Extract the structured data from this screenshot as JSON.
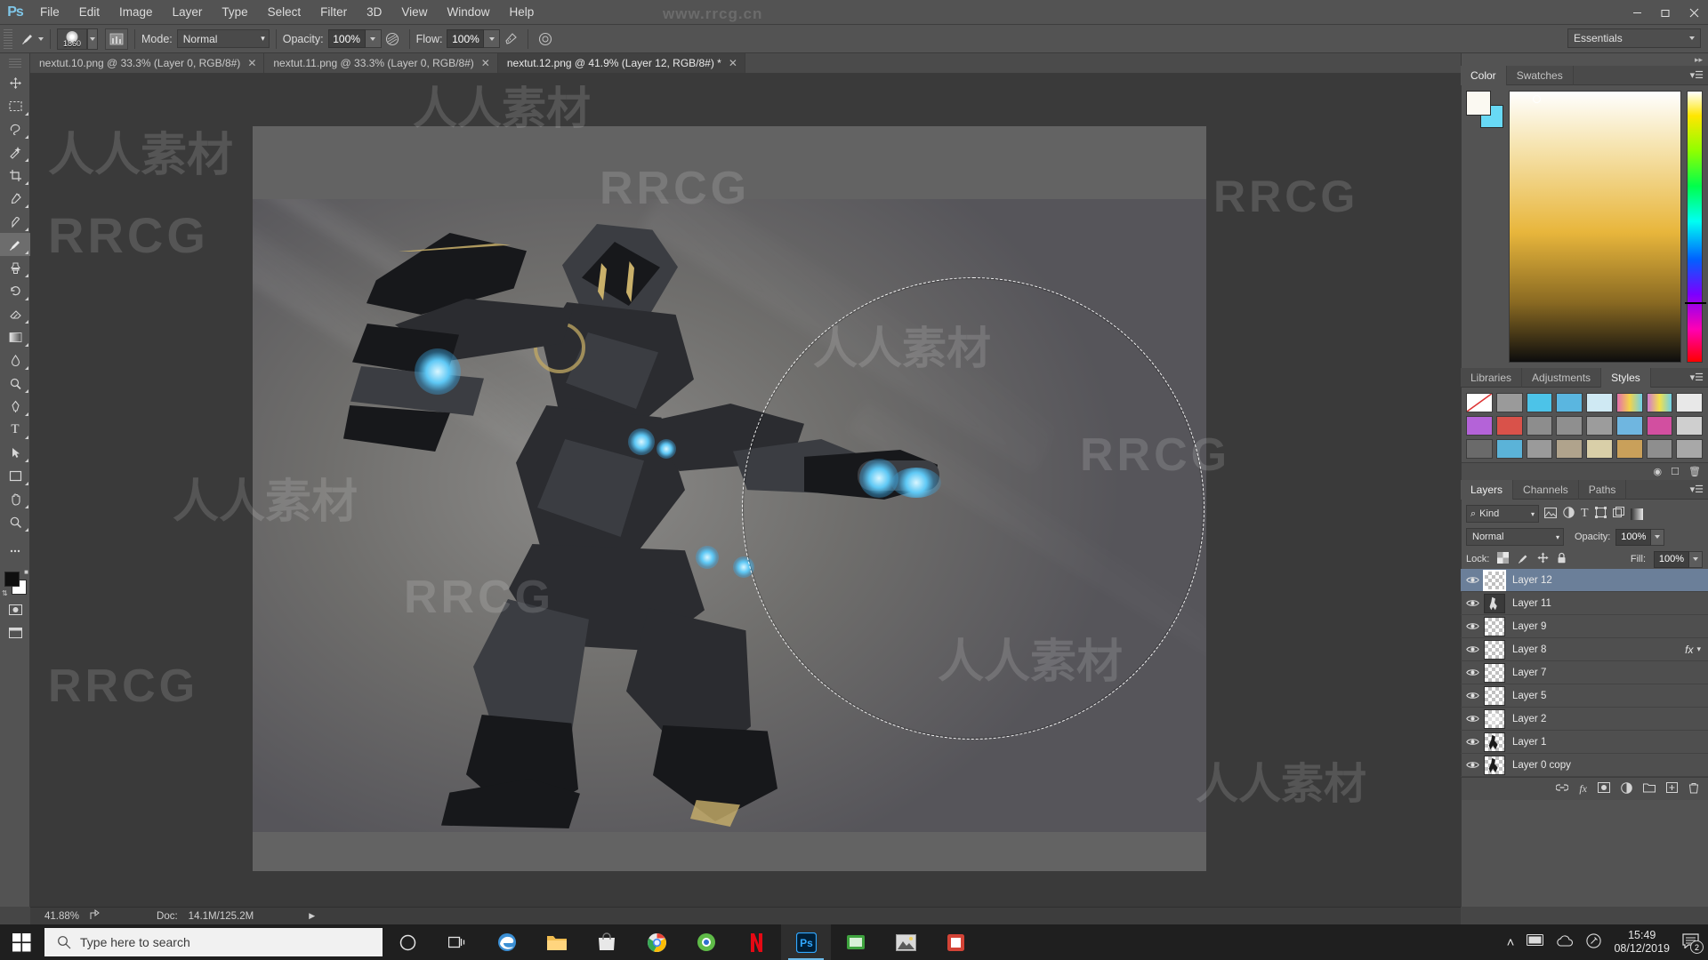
{
  "app": {
    "name": "Adobe Photoshop",
    "logo_text": "Ps"
  },
  "menubar": {
    "items": [
      {
        "label": "File"
      },
      {
        "label": "Edit"
      },
      {
        "label": "Image"
      },
      {
        "label": "Layer"
      },
      {
        "label": "Type"
      },
      {
        "label": "Select"
      },
      {
        "label": "Filter"
      },
      {
        "label": "3D"
      },
      {
        "label": "View"
      },
      {
        "label": "Window"
      },
      {
        "label": "Help"
      }
    ],
    "window_controls": {
      "minimize": "—",
      "restore": "❐",
      "close": "✕"
    }
  },
  "watermarks": {
    "site": "www.rrcg.cn",
    "brand": "RRCG",
    "chinese": "人人素材"
  },
  "options_bar": {
    "tool_icon": "brush-icon",
    "brush_size": "1860",
    "mode_label": "Mode:",
    "mode_value": "Normal",
    "opacity_label": "Opacity:",
    "opacity_value": "100%",
    "flow_label": "Flow:",
    "flow_value": "100%",
    "airbrush_icon": "airbrush-icon",
    "smoothing_icon": "smoothing-icon",
    "tablet_pressure_icon": "tablet-pressure-icon",
    "workspace_selector": "Essentials"
  },
  "tabs": [
    {
      "title": "nextut.10.png @ 33.3% (Layer 0, RGB/8#)",
      "close": "✕",
      "active": false
    },
    {
      "title": "nextut.11.png @ 33.3% (Layer 0, RGB/8#)",
      "close": "✕",
      "active": false
    },
    {
      "title": "nextut.12.png @ 41.9% (Layer 12, RGB/8#) *",
      "close": "✕",
      "active": true
    }
  ],
  "toolbox": {
    "tools": [
      {
        "name": "move-tool",
        "glyph": "✚"
      },
      {
        "name": "rectangular-marquee-tool",
        "glyph": "⬚"
      },
      {
        "name": "lasso-tool",
        "glyph": "⬭"
      },
      {
        "name": "quick-selection-tool",
        "glyph": "✦"
      },
      {
        "name": "crop-tool",
        "glyph": "⌗"
      },
      {
        "name": "eyedropper-tool",
        "glyph": "✐"
      },
      {
        "name": "spot-healing-brush-tool",
        "glyph": "✒"
      },
      {
        "name": "brush-tool",
        "glyph": "✎",
        "active": true
      },
      {
        "name": "clone-stamp-tool",
        "glyph": "⎙"
      },
      {
        "name": "history-brush-tool",
        "glyph": "↺"
      },
      {
        "name": "eraser-tool",
        "glyph": "◧"
      },
      {
        "name": "gradient-tool",
        "glyph": "▣"
      },
      {
        "name": "blur-tool",
        "glyph": "●"
      },
      {
        "name": "dodge-tool",
        "glyph": "◔"
      },
      {
        "name": "pen-tool",
        "glyph": "✑"
      },
      {
        "name": "horizontal-type-tool",
        "glyph": "T"
      },
      {
        "name": "path-selection-tool",
        "glyph": "↖"
      },
      {
        "name": "rectangle-tool",
        "glyph": "□"
      },
      {
        "name": "hand-tool",
        "glyph": "✋"
      },
      {
        "name": "zoom-tool",
        "glyph": "○"
      }
    ],
    "foreground_color": "#0f0f0f",
    "background_color": "#ffffff",
    "quick-mask-name": "quick-mask-toggle",
    "screen-mode-name": "screen-mode-toggle"
  },
  "status_bar": {
    "zoom": "41.88%",
    "doc_label": "Doc:",
    "doc_value": "14.1M/125.2M",
    "arrow": "▶"
  },
  "dock": {
    "color_panel": {
      "tabs": [
        {
          "label": "Color",
          "active": true
        },
        {
          "label": "Swatches",
          "active": false
        }
      ],
      "foreground_hex": "#fbf9f2",
      "background_hex": "#68d9f5",
      "ramp_hex": "#e8b63c"
    },
    "styles_panel": {
      "tabs": [
        {
          "label": "Libraries",
          "active": false
        },
        {
          "label": "Adjustments",
          "active": false
        },
        {
          "label": "Styles",
          "active": true
        }
      ],
      "swatch_colors": [
        "#ffffff",
        "#9a9a9a",
        "#4cc3e8",
        "#5ab6e0",
        "#cfe9f3",
        "#e46fae",
        "#d07ad0",
        "#e8e8e8",
        "#b463d8",
        "#d9524a",
        "#8d8d8d",
        "#8f8f8f",
        "#9c9c9c",
        "#6fb6e0",
        "#d24fa0",
        "#cfcfcf",
        "#6a6a6a",
        "#5bb3d8",
        "#9a9a9a",
        "#b0a38c",
        "#d9cfa8",
        "#c9a05a",
        "#8e8e8e",
        "#a8a8a8"
      ]
    },
    "layers_panel": {
      "tabs": [
        {
          "label": "Layers",
          "active": true
        },
        {
          "label": "Channels",
          "active": false
        },
        {
          "label": "Paths",
          "active": false
        }
      ],
      "filter_label": "Kind",
      "filter_icons": [
        "image-filter-icon",
        "adjustment-filter-icon",
        "type-filter-icon",
        "shape-filter-icon",
        "smart-object-filter-icon"
      ],
      "blend_mode": "Normal",
      "opacity_label": "Opacity:",
      "opacity_value": "100%",
      "lock_label": "Lock:",
      "lock_icons": [
        "lock-transparent-pixels-icon",
        "lock-image-pixels-icon",
        "lock-position-icon",
        "lock-all-icon"
      ],
      "fill_label": "Fill:",
      "fill_value": "100%",
      "layers": [
        {
          "name": "Layer 12",
          "visible": true,
          "selected": true,
          "thumb": "transparent",
          "fx": false
        },
        {
          "name": "Layer 11",
          "visible": true,
          "selected": false,
          "thumb": "art",
          "fx": false
        },
        {
          "name": "Layer 9",
          "visible": true,
          "selected": false,
          "thumb": "transparent",
          "fx": false
        },
        {
          "name": "Layer 8",
          "visible": true,
          "selected": false,
          "thumb": "transparent",
          "fx": true,
          "fx_label": "fx"
        },
        {
          "name": "Layer 7",
          "visible": true,
          "selected": false,
          "thumb": "transparent",
          "fx": false
        },
        {
          "name": "Layer 5",
          "visible": true,
          "selected": false,
          "thumb": "transparent",
          "fx": false
        },
        {
          "name": "Layer 2",
          "visible": true,
          "selected": false,
          "thumb": "transparent",
          "fx": false
        },
        {
          "name": "Layer 1",
          "visible": true,
          "selected": false,
          "thumb": "art",
          "fx": false
        },
        {
          "name": "Layer 0 copy",
          "visible": true,
          "selected": false,
          "thumb": "art",
          "fx": false
        }
      ],
      "footer_icons": [
        "link-layers-icon",
        "layer-style-icon",
        "layer-mask-icon",
        "adjustment-layer-icon",
        "new-group-icon",
        "new-layer-icon",
        "delete-layer-icon"
      ]
    }
  },
  "taskbar": {
    "start_name": "start-button",
    "search_placeholder": "Type here to search",
    "search_icon": "search-icon",
    "buttons": [
      {
        "name": "cortana-button",
        "glyph": "○"
      },
      {
        "name": "task-view-button",
        "glyph": "⌸"
      },
      {
        "name": "edge-button",
        "glyph": "e",
        "color": "#4aa7e0"
      },
      {
        "name": "file-explorer-button",
        "glyph": "⬛",
        "color": "#e8b44a"
      },
      {
        "name": "microsoft-store-button",
        "glyph": "⬛",
        "color": "#d8d8d8"
      },
      {
        "name": "chrome-button",
        "glyph": "◉",
        "color": "#e0564a"
      },
      {
        "name": "browser-button",
        "glyph": "◉",
        "color": "#6bb94a"
      },
      {
        "name": "netflix-button",
        "glyph": "N",
        "color": "#e3000f"
      },
      {
        "name": "photoshop-button",
        "glyph": "Ps",
        "color": "#31a8ff",
        "active": true
      },
      {
        "name": "greenshot-button",
        "glyph": "⬛",
        "color": "#3ea33e"
      },
      {
        "name": "image-viewer-button",
        "glyph": "⛰",
        "color": "#cfcfcf"
      },
      {
        "name": "app-button",
        "glyph": "⬛",
        "color": "#d34336"
      }
    ],
    "tray": {
      "chevron": "˄",
      "icons": [
        "screen-icon",
        "cloud-icon",
        "pen-icon"
      ],
      "time": "15:49",
      "date": "08/12/2019",
      "notification_count": "2"
    }
  }
}
